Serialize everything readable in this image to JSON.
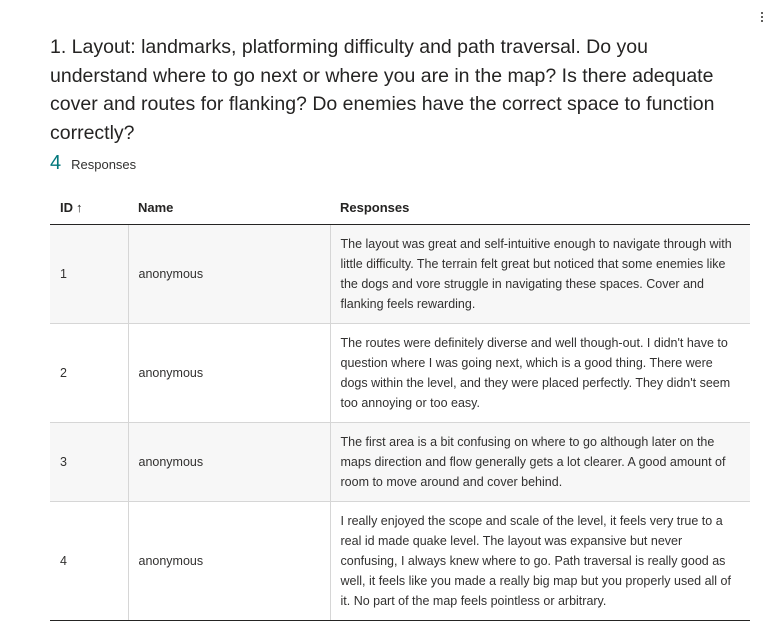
{
  "question": {
    "title": "1. Layout: landmarks, platforming difficulty and path traversal. Do you understand where to go next or where you are in the map? Is there adequate cover and routes for flanking? Do enemies have the correct space to function correctly?"
  },
  "summary": {
    "count": "4",
    "label": "Responses"
  },
  "table": {
    "headers": {
      "id": "ID",
      "id_sort_icon": "sort-ascending-arrow",
      "name": "Name",
      "responses": "Responses"
    },
    "rows": [
      {
        "id": "1",
        "name": "anonymous",
        "response": "The layout was great and self-intuitive enough to navigate through with little difficulty. The terrain felt great but noticed that some enemies like the dogs and vore struggle in navigating these spaces. Cover and flanking feels rewarding."
      },
      {
        "id": "2",
        "name": "anonymous",
        "response": "The routes were definitely diverse and well though-out. I didn't have to question where I was going next, which is a good thing. There were dogs within the level, and they were placed perfectly. They didn't seem too annoying or too easy."
      },
      {
        "id": "3",
        "name": "anonymous",
        "response": "The first area is a bit confusing on where to go although later on the maps direction and flow generally gets a lot clearer. A good amount of room to move around and cover behind."
      },
      {
        "id": "4",
        "name": "anonymous",
        "response": "I really enjoyed the scope and scale of the level, it feels very true to a real id made quake level. The layout was expansive but never confusing, I always knew where to go. Path traversal is really good as well, it feels like you made a really big map but you properly used all of it. No part of the map feels pointless or arbitrary."
      }
    ]
  },
  "colors": {
    "accent": "#03787c",
    "text": "#252423",
    "row_alt": "#f7f7f7",
    "border": "#d6d6d6"
  },
  "icons": {
    "more": "more-options-icon"
  }
}
